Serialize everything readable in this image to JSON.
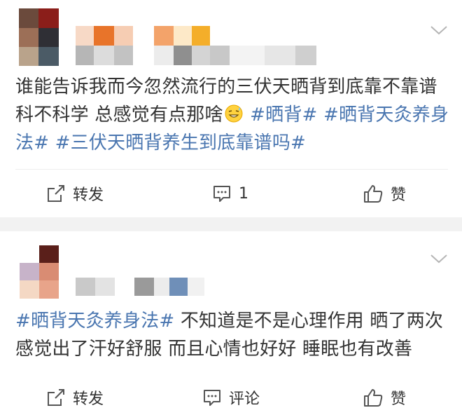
{
  "post_1": {
    "content": {
      "text_1": "谁能告诉我而今忽然流行的三伏天晒背到底靠不靠谱科不科学 总感觉有点那啥",
      "emoji": "grin-sweat-emoji",
      "tag_1": "#晒背#",
      "tag_2": "#晒背天灸养身法#",
      "tag_3": "#三伏天晒背养生到底靠谱吗#"
    },
    "actions": {
      "repost_label": "转发",
      "comment_label": "1",
      "like_label": "赞"
    }
  },
  "post_2": {
    "content": {
      "tag_1": "#晒背天灸养身法#",
      "text_1": " 不知道是不是心理作用 晒了两次感觉出了汗好舒服 而且心情也好好 睡眠也有改善"
    },
    "actions": {
      "repost_label": "转发",
      "comment_label": "评论",
      "like_label": "赞"
    }
  },
  "colors": {
    "hashtag": "#4a76b0",
    "text": "#333333",
    "icon": "#555555",
    "separator": "#f2f2f2"
  },
  "icons": {
    "repost": "repost-icon",
    "comment": "comment-icon",
    "like": "thumbs-up-icon",
    "menu": "chevron-down-icon"
  }
}
